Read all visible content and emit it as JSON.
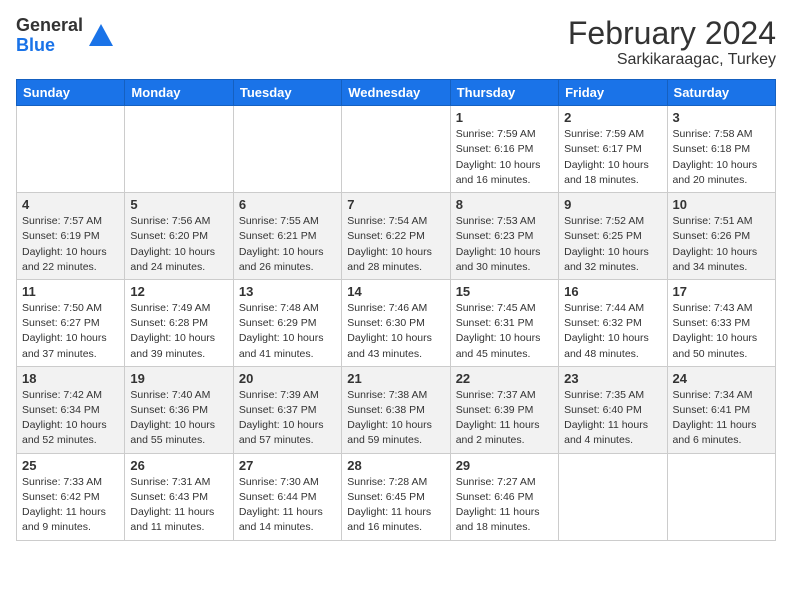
{
  "header": {
    "logo_general": "General",
    "logo_blue": "Blue",
    "month_year": "February 2024",
    "location": "Sarkikaraagac, Turkey"
  },
  "days_of_week": [
    "Sunday",
    "Monday",
    "Tuesday",
    "Wednesday",
    "Thursday",
    "Friday",
    "Saturday"
  ],
  "weeks": [
    [
      {
        "day": "",
        "info": ""
      },
      {
        "day": "",
        "info": ""
      },
      {
        "day": "",
        "info": ""
      },
      {
        "day": "",
        "info": ""
      },
      {
        "day": "1",
        "info": "Sunrise: 7:59 AM\nSunset: 6:16 PM\nDaylight: 10 hours\nand 16 minutes."
      },
      {
        "day": "2",
        "info": "Sunrise: 7:59 AM\nSunset: 6:17 PM\nDaylight: 10 hours\nand 18 minutes."
      },
      {
        "day": "3",
        "info": "Sunrise: 7:58 AM\nSunset: 6:18 PM\nDaylight: 10 hours\nand 20 minutes."
      }
    ],
    [
      {
        "day": "4",
        "info": "Sunrise: 7:57 AM\nSunset: 6:19 PM\nDaylight: 10 hours\nand 22 minutes."
      },
      {
        "day": "5",
        "info": "Sunrise: 7:56 AM\nSunset: 6:20 PM\nDaylight: 10 hours\nand 24 minutes."
      },
      {
        "day": "6",
        "info": "Sunrise: 7:55 AM\nSunset: 6:21 PM\nDaylight: 10 hours\nand 26 minutes."
      },
      {
        "day": "7",
        "info": "Sunrise: 7:54 AM\nSunset: 6:22 PM\nDaylight: 10 hours\nand 28 minutes."
      },
      {
        "day": "8",
        "info": "Sunrise: 7:53 AM\nSunset: 6:23 PM\nDaylight: 10 hours\nand 30 minutes."
      },
      {
        "day": "9",
        "info": "Sunrise: 7:52 AM\nSunset: 6:25 PM\nDaylight: 10 hours\nand 32 minutes."
      },
      {
        "day": "10",
        "info": "Sunrise: 7:51 AM\nSunset: 6:26 PM\nDaylight: 10 hours\nand 34 minutes."
      }
    ],
    [
      {
        "day": "11",
        "info": "Sunrise: 7:50 AM\nSunset: 6:27 PM\nDaylight: 10 hours\nand 37 minutes."
      },
      {
        "day": "12",
        "info": "Sunrise: 7:49 AM\nSunset: 6:28 PM\nDaylight: 10 hours\nand 39 minutes."
      },
      {
        "day": "13",
        "info": "Sunrise: 7:48 AM\nSunset: 6:29 PM\nDaylight: 10 hours\nand 41 minutes."
      },
      {
        "day": "14",
        "info": "Sunrise: 7:46 AM\nSunset: 6:30 PM\nDaylight: 10 hours\nand 43 minutes."
      },
      {
        "day": "15",
        "info": "Sunrise: 7:45 AM\nSunset: 6:31 PM\nDaylight: 10 hours\nand 45 minutes."
      },
      {
        "day": "16",
        "info": "Sunrise: 7:44 AM\nSunset: 6:32 PM\nDaylight: 10 hours\nand 48 minutes."
      },
      {
        "day": "17",
        "info": "Sunrise: 7:43 AM\nSunset: 6:33 PM\nDaylight: 10 hours\nand 50 minutes."
      }
    ],
    [
      {
        "day": "18",
        "info": "Sunrise: 7:42 AM\nSunset: 6:34 PM\nDaylight: 10 hours\nand 52 minutes."
      },
      {
        "day": "19",
        "info": "Sunrise: 7:40 AM\nSunset: 6:36 PM\nDaylight: 10 hours\nand 55 minutes."
      },
      {
        "day": "20",
        "info": "Sunrise: 7:39 AM\nSunset: 6:37 PM\nDaylight: 10 hours\nand 57 minutes."
      },
      {
        "day": "21",
        "info": "Sunrise: 7:38 AM\nSunset: 6:38 PM\nDaylight: 10 hours\nand 59 minutes."
      },
      {
        "day": "22",
        "info": "Sunrise: 7:37 AM\nSunset: 6:39 PM\nDaylight: 11 hours\nand 2 minutes."
      },
      {
        "day": "23",
        "info": "Sunrise: 7:35 AM\nSunset: 6:40 PM\nDaylight: 11 hours\nand 4 minutes."
      },
      {
        "day": "24",
        "info": "Sunrise: 7:34 AM\nSunset: 6:41 PM\nDaylight: 11 hours\nand 6 minutes."
      }
    ],
    [
      {
        "day": "25",
        "info": "Sunrise: 7:33 AM\nSunset: 6:42 PM\nDaylight: 11 hours\nand 9 minutes."
      },
      {
        "day": "26",
        "info": "Sunrise: 7:31 AM\nSunset: 6:43 PM\nDaylight: 11 hours\nand 11 minutes."
      },
      {
        "day": "27",
        "info": "Sunrise: 7:30 AM\nSunset: 6:44 PM\nDaylight: 11 hours\nand 14 minutes."
      },
      {
        "day": "28",
        "info": "Sunrise: 7:28 AM\nSunset: 6:45 PM\nDaylight: 11 hours\nand 16 minutes."
      },
      {
        "day": "29",
        "info": "Sunrise: 7:27 AM\nSunset: 6:46 PM\nDaylight: 11 hours\nand 18 minutes."
      },
      {
        "day": "",
        "info": ""
      },
      {
        "day": "",
        "info": ""
      }
    ]
  ]
}
